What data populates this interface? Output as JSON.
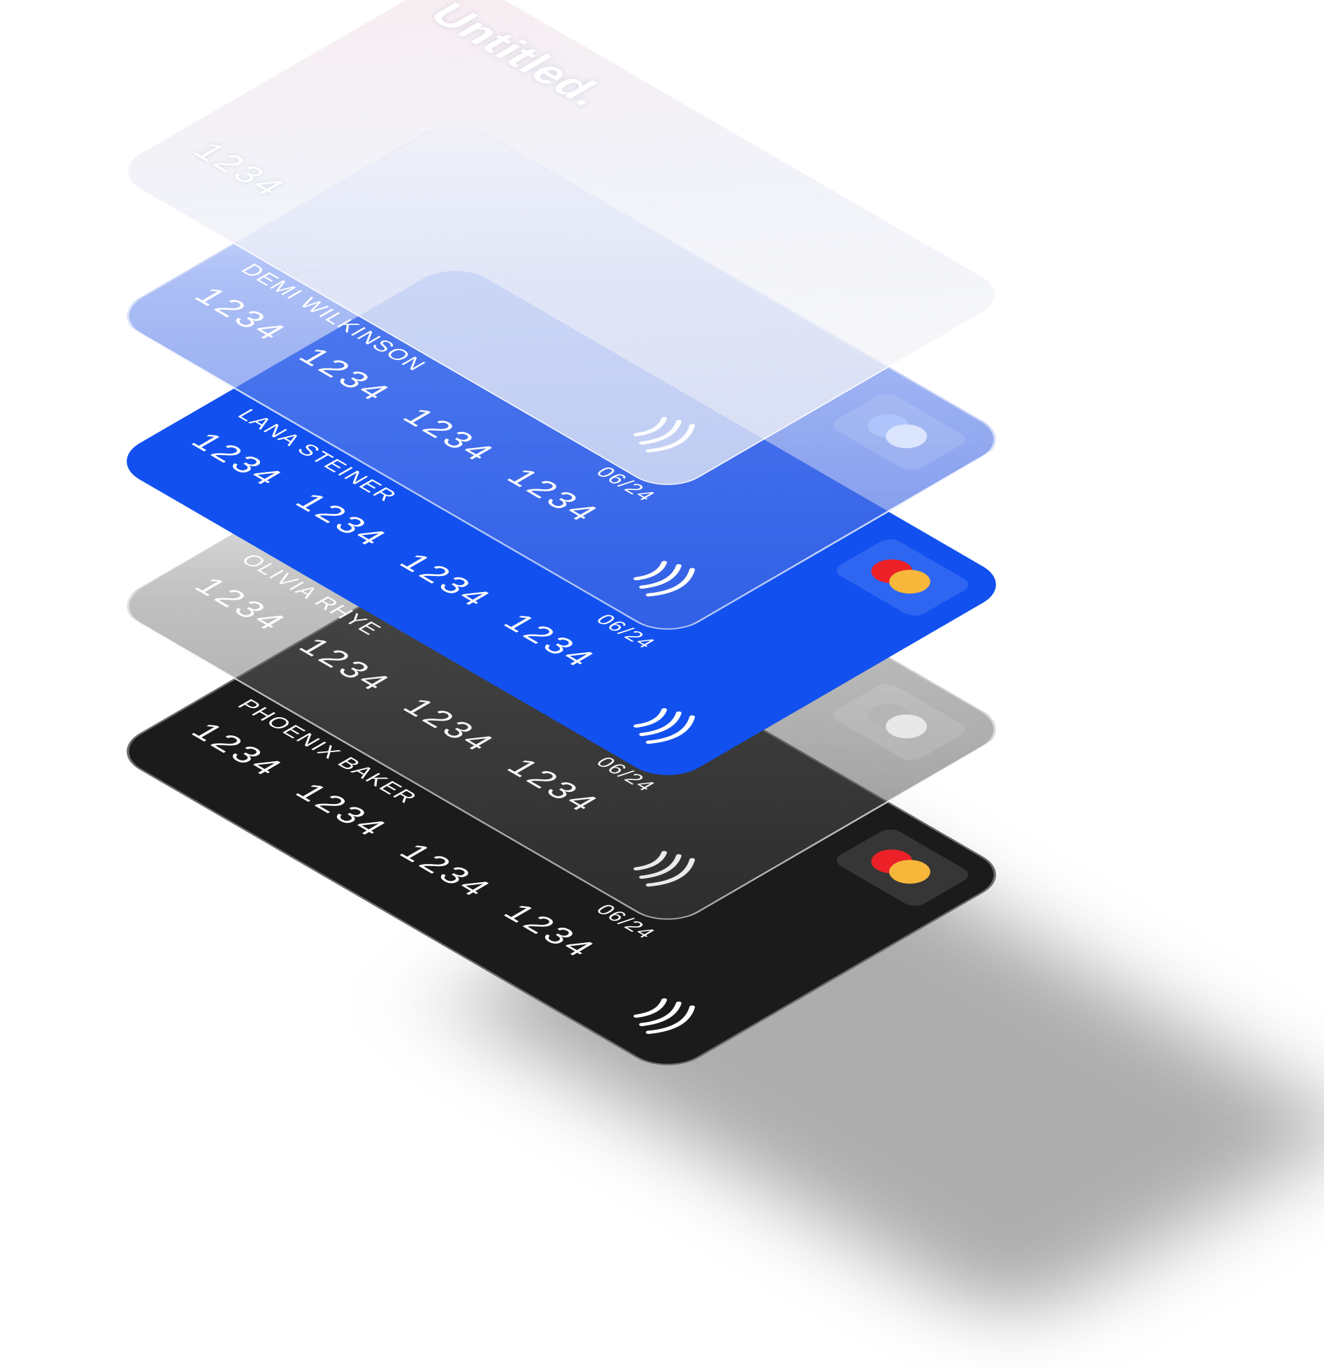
{
  "cards": [
    {
      "style": "black",
      "holder": "PHOENIX BAKER",
      "number": "1234 1234 1234 1234",
      "expiry": "06/24",
      "logo": "mastercard-icon",
      "logo_colors": [
        "#eb2127",
        "#f7b73a"
      ],
      "contactless": "contactless-icon"
    },
    {
      "style": "glass-dark",
      "holder": "OLIVIA RHYE",
      "number": "1234 1234 1234 1234",
      "expiry": "06/24",
      "logo": "card-logo-icon",
      "logo_colors": [
        "#b5b5b5",
        "#e8e8e8"
      ],
      "contactless": "contactless-icon"
    },
    {
      "style": "blue",
      "holder": "LANA STEINER",
      "number": "1234 1234 1234 1234",
      "expiry": "06/24",
      "logo": "mastercard-icon",
      "logo_colors": [
        "#eb2127",
        "#f7b73a"
      ],
      "contactless": "contactless-icon"
    },
    {
      "style": "glass-blue",
      "holder": "DEMI WILKINSON",
      "number": "1234 1234 1234 1234",
      "expiry": "06/24",
      "logo": "card-logo-icon",
      "logo_colors": [
        "#aec4fb",
        "#dbe5fd"
      ],
      "contactless": "contactless-icon"
    },
    {
      "style": "glass-light",
      "brand": "Untitled.",
      "holder": "",
      "number": "1234",
      "contactless": "contactless-icon"
    }
  ],
  "colors": {
    "blue": "#1251ef",
    "black": "#1b1b1b",
    "mastercard_red": "#eb2127",
    "mastercard_yellow": "#f7b73a"
  }
}
